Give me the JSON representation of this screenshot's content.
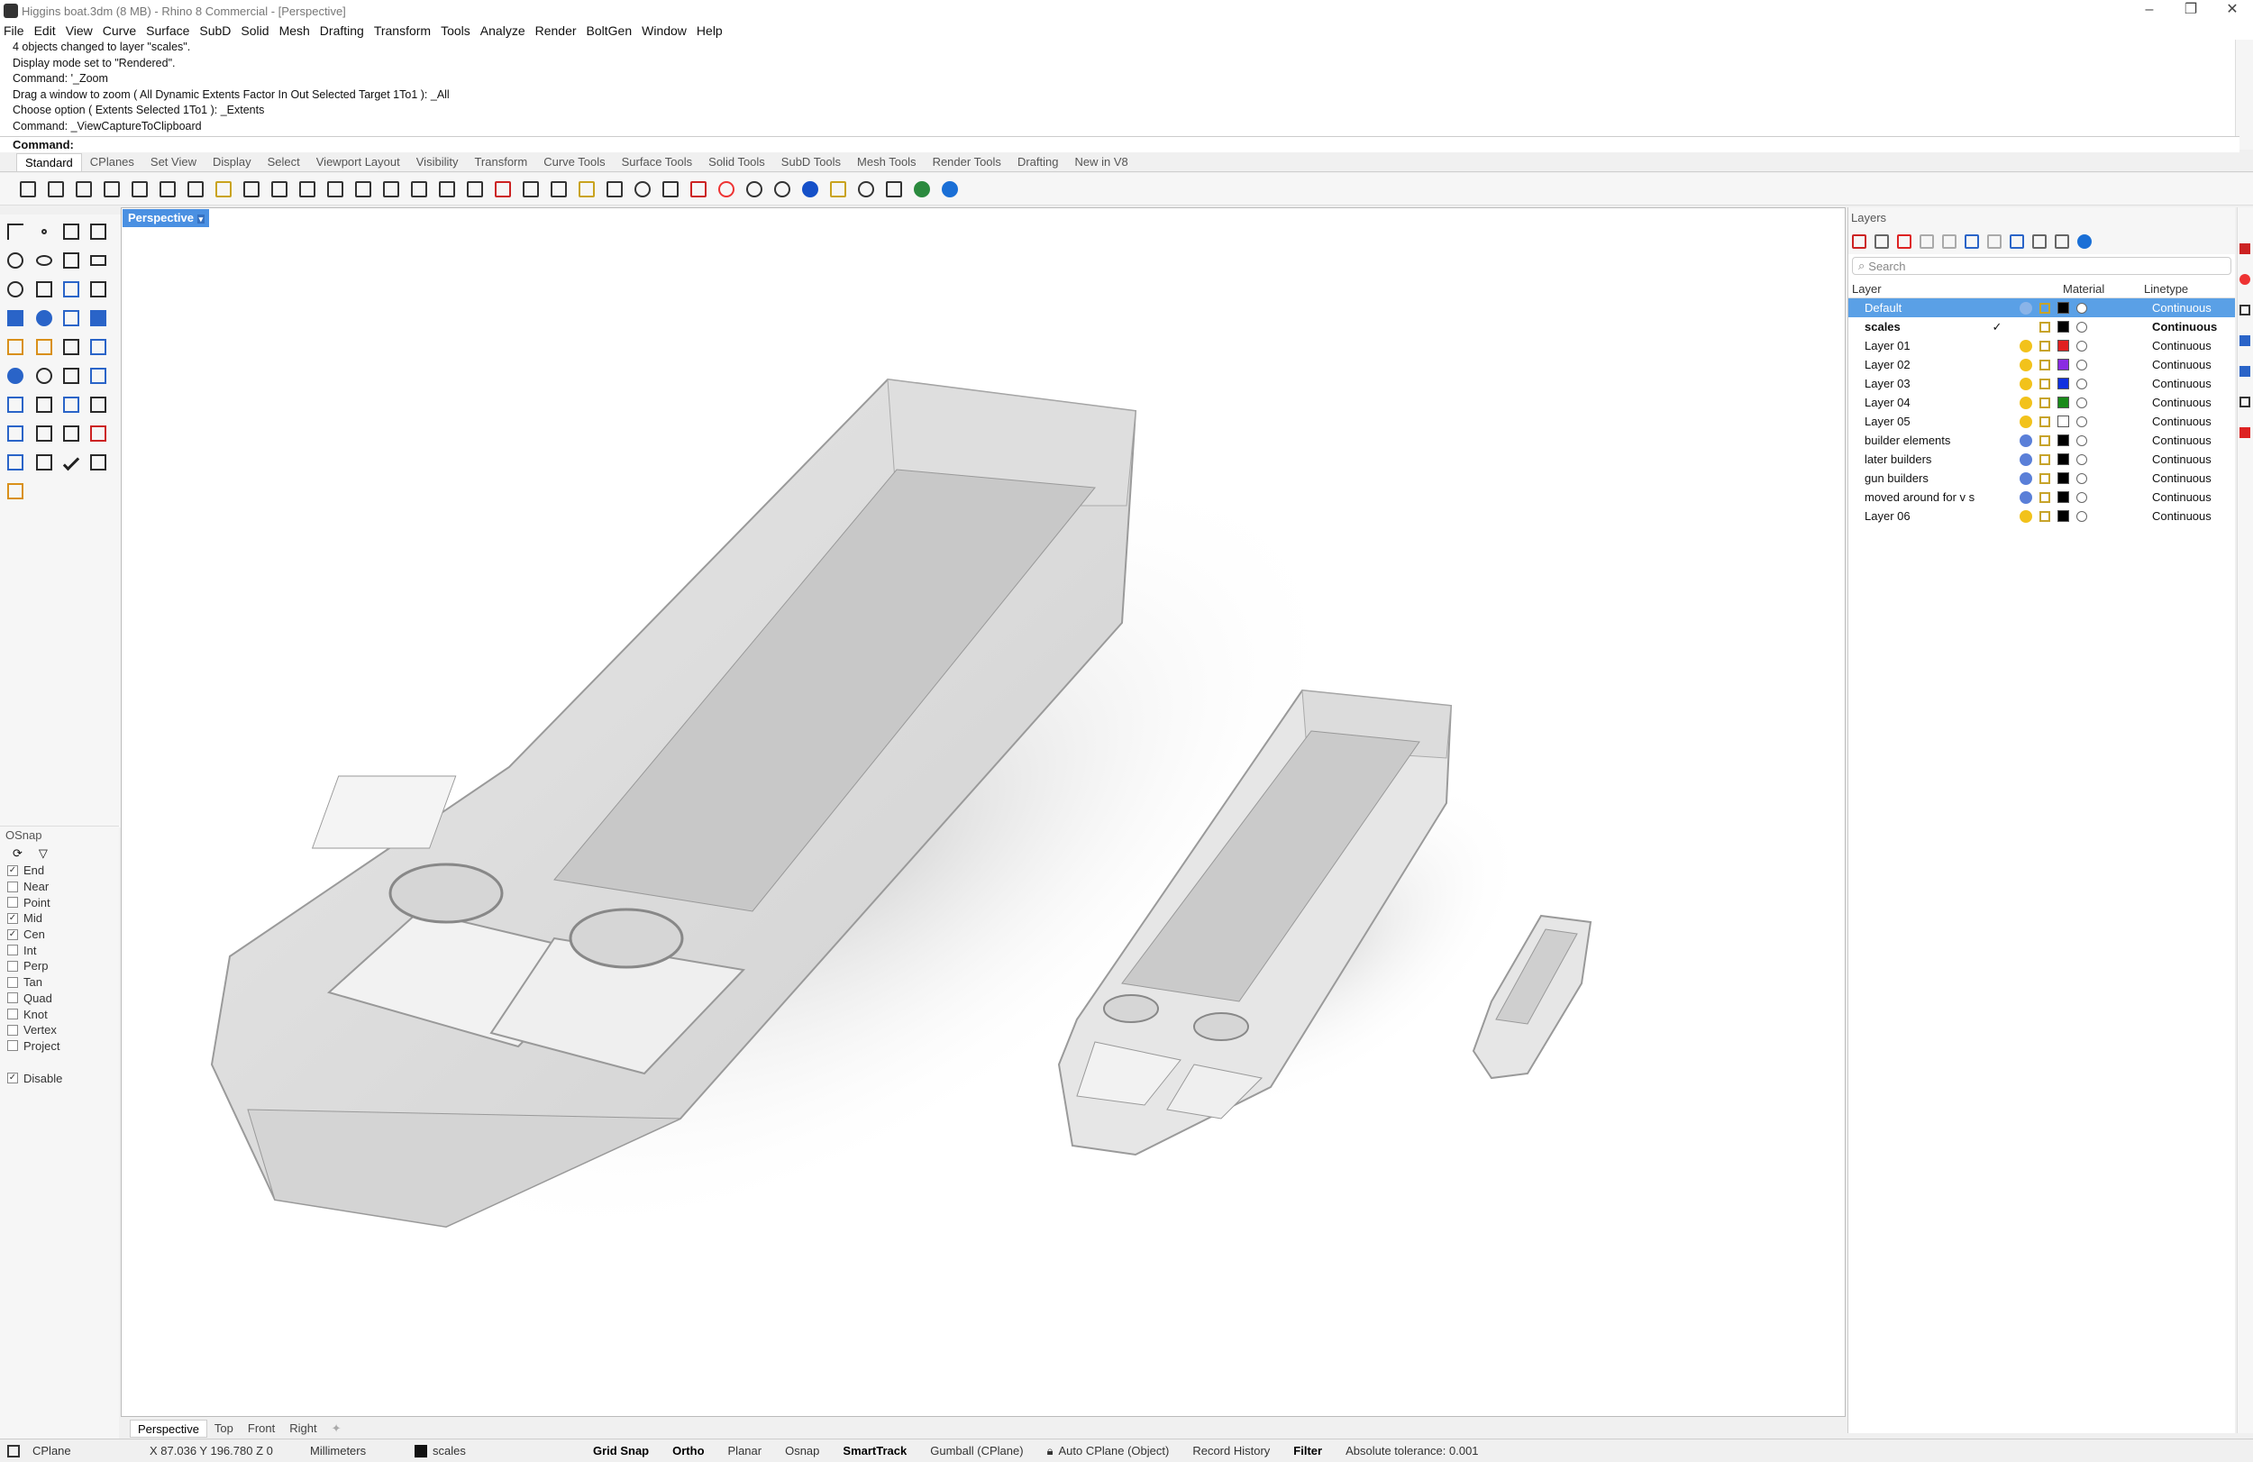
{
  "window": {
    "title": "Higgins boat.3dm (8 MB) - Rhino 8 Commercial - [Perspective]"
  },
  "menu": [
    "File",
    "Edit",
    "View",
    "Curve",
    "Surface",
    "SubD",
    "Solid",
    "Mesh",
    "Drafting",
    "Transform",
    "Tools",
    "Analyze",
    "Render",
    "BoltGen",
    "Window",
    "Help"
  ],
  "command_history": [
    "4 objects changed to layer \"scales\".",
    "Display mode set to \"Rendered\".",
    "Command: '_Zoom",
    "Drag a window to zoom ( All  Dynamic  Extents  Factor  In  Out  Selected  Target  1To1 ): _All",
    "Choose option ( Extents  Selected  1To1 ): _Extents",
    "Command: _ViewCaptureToClipboard"
  ],
  "command_prompt": "Command:",
  "toolbar_tabs": [
    "Standard",
    "CPlanes",
    "Set View",
    "Display",
    "Select",
    "Viewport Layout",
    "Visibility",
    "Transform",
    "Curve Tools",
    "Surface Tools",
    "Solid Tools",
    "SubD Tools",
    "Mesh Tools",
    "Render Tools",
    "Drafting",
    "New in V8"
  ],
  "active_toolbar_tab": "Standard",
  "viewport": {
    "active_label": "Perspective",
    "tabs": [
      "Perspective",
      "Top",
      "Front",
      "Right"
    ]
  },
  "osnap": {
    "title": "OSnap",
    "items": [
      {
        "label": "End",
        "checked": true
      },
      {
        "label": "Near",
        "checked": false
      },
      {
        "label": "Point",
        "checked": false
      },
      {
        "label": "Mid",
        "checked": true
      },
      {
        "label": "Cen",
        "checked": true
      },
      {
        "label": "Int",
        "checked": false
      },
      {
        "label": "Perp",
        "checked": false
      },
      {
        "label": "Tan",
        "checked": false
      },
      {
        "label": "Quad",
        "checked": false
      },
      {
        "label": "Knot",
        "checked": false
      },
      {
        "label": "Vertex",
        "checked": false
      },
      {
        "label": "Project",
        "checked": false
      }
    ],
    "disable_label": "Disable",
    "disable_checked": true
  },
  "layers": {
    "title": "Layers",
    "search_placeholder": "Search",
    "headers": {
      "layer": "Layer",
      "material": "Material",
      "linetype": "Linetype"
    },
    "rows": [
      {
        "name": "Default",
        "color": "#000000",
        "linetype": "Continuous",
        "selected": true,
        "current": false,
        "bulb": "#8ab4e8"
      },
      {
        "name": "scales",
        "color": "#000000",
        "linetype": "Continuous",
        "selected": false,
        "current": true,
        "bold": true,
        "bulb": ""
      },
      {
        "name": "Layer 01",
        "color": "#e02020",
        "linetype": "Continuous",
        "selected": false,
        "current": false,
        "bulb": "#f2c21b"
      },
      {
        "name": "Layer 02",
        "color": "#8a2be2",
        "linetype": "Continuous",
        "selected": false,
        "current": false,
        "bulb": "#f2c21b"
      },
      {
        "name": "Layer 03",
        "color": "#1030e0",
        "linetype": "Continuous",
        "selected": false,
        "current": false,
        "bulb": "#f2c21b"
      },
      {
        "name": "Layer 04",
        "color": "#1a8a1a",
        "linetype": "Continuous",
        "selected": false,
        "current": false,
        "bulb": "#f2c21b"
      },
      {
        "name": "Layer 05",
        "color": "#ffffff",
        "linetype": "Continuous",
        "selected": false,
        "current": false,
        "bulb": "#f2c21b"
      },
      {
        "name": "builder elements",
        "color": "#000000",
        "linetype": "Continuous",
        "selected": false,
        "current": false,
        "bulb": "#5a7fd8"
      },
      {
        "name": "later builders",
        "color": "#000000",
        "linetype": "Continuous",
        "selected": false,
        "current": false,
        "bulb": "#5a7fd8"
      },
      {
        "name": "gun builders",
        "color": "#000000",
        "linetype": "Continuous",
        "selected": false,
        "current": false,
        "bulb": "#5a7fd8"
      },
      {
        "name": "moved around for v s",
        "color": "#000000",
        "linetype": "Continuous",
        "selected": false,
        "current": false,
        "bulb": "#5a7fd8"
      },
      {
        "name": "Layer 06",
        "color": "#000000",
        "linetype": "Continuous",
        "selected": false,
        "current": false,
        "bulb": "#f2c21b"
      }
    ]
  },
  "status": {
    "cplane": "CPlane",
    "coords": "X 87.036 Y 196.780 Z 0",
    "units": "Millimeters",
    "layer": "scales",
    "grid_snap": "Grid Snap",
    "ortho": "Ortho",
    "planar": "Planar",
    "osnap": "Osnap",
    "smarttrack": "SmartTrack",
    "gumball": "Gumball (CPlane)",
    "auto_cplane": "Auto CPlane (Object)",
    "record_history": "Record History",
    "filter": "Filter",
    "tolerance": "Absolute tolerance: 0.001"
  }
}
